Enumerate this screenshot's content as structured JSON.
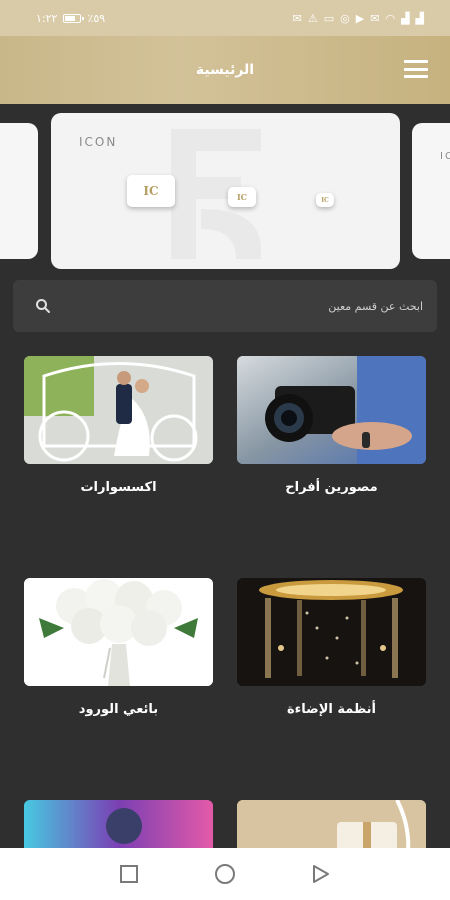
{
  "status_bar": {
    "time": "١:٢٢",
    "battery": "٪٥٩",
    "left_icons": [
      "mail-icon",
      "warning-icon",
      "message-icon",
      "whatsapp-icon",
      "youtube-icon",
      "mail-icon"
    ],
    "right_icons": [
      "wifi-icon",
      "signal-icon",
      "signal-icon"
    ]
  },
  "app_bar": {
    "title": "الرئيسية",
    "menu_icon": "hamburger-menu-icon"
  },
  "banner": {
    "logo_text": "ICON",
    "badge_letters": "IC"
  },
  "search": {
    "placeholder": "ابحث عن قسم معين",
    "icon": "search-icon"
  },
  "categories": [
    {
      "label": "مصورين أفراح",
      "image": "photographer-camera"
    },
    {
      "label": "اكسسوارات",
      "image": "wedding-carriage-couple"
    },
    {
      "label": "أنظمة الإضاءة",
      "image": "lighting-gazebo"
    },
    {
      "label": "بائعي الورود",
      "image": "white-roses-bouquet"
    },
    {
      "label": "",
      "image": "colorful-smoke"
    },
    {
      "label": "",
      "image": "gift-boxes"
    }
  ],
  "nav_bar": {
    "buttons": [
      "recent-apps-icon",
      "home-icon",
      "back-icon"
    ]
  },
  "colors": {
    "accent": "#c9b787",
    "background": "#2f2f2f",
    "search_bg": "#3d3d3d"
  }
}
